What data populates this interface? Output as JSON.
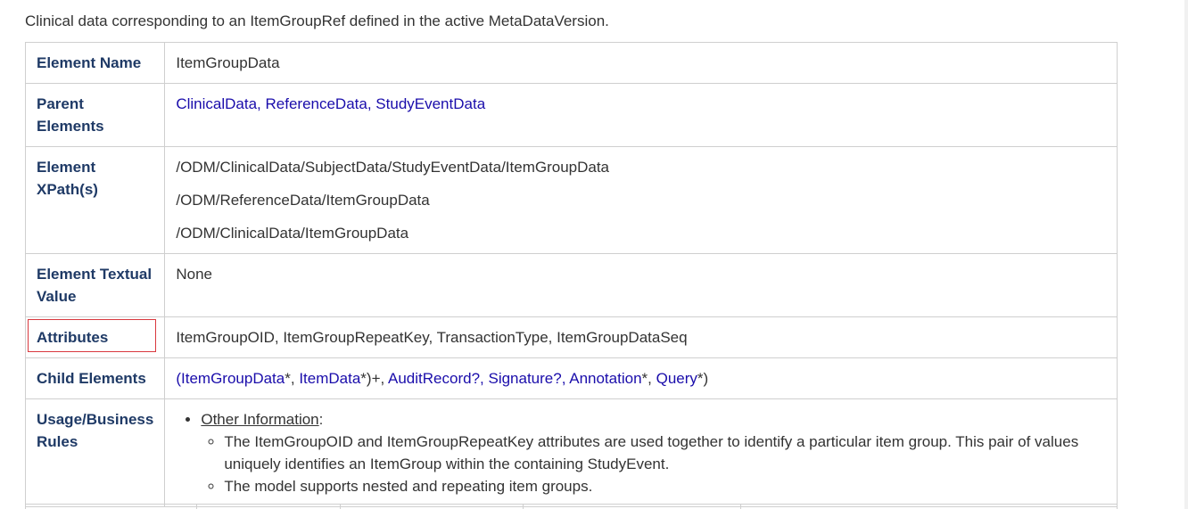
{
  "intro": "Clinical data corresponding to an ItemGroupRef defined in the active MetaDataVersion.",
  "rows": {
    "element_name": {
      "label": "Element Name",
      "value": "ItemGroupData"
    },
    "parent_elements": {
      "label": "Parent Elements",
      "links": [
        "ClinicalData",
        "ReferenceData",
        "StudyEventData"
      ],
      "separator": ", "
    },
    "xpaths": {
      "label": "Element XPath(s)",
      "values": [
        "/ODM/ClinicalData/SubjectData/StudyEventData/ItemGroupData",
        "/ODM/ReferenceData/ItemGroupData",
        "/ODM/ClinicalData/ItemGroupData"
      ]
    },
    "textual_value": {
      "label": "Element Textual Value",
      "value": "None"
    },
    "attributes": {
      "label": "Attributes",
      "value": "ItemGroupOID, ItemGroupRepeatKey, TransactionType, ItemGroupDataSeq"
    },
    "child_elements": {
      "label": "Child Elements",
      "open": "(",
      "link1": "ItemGroupData",
      "sym1": "*, ",
      "link2": "ItemData",
      "sym2": "*)+, ",
      "link3": "AuditRecord",
      "sym3": "?, ",
      "link4": "Signature",
      "sym4": "?, ",
      "link5": "Annotation",
      "sym5": "*, ",
      "link6": "Query",
      "sym6": "*)"
    },
    "usage": {
      "label": "Usage/Business Rules",
      "item_title": "Other Information",
      "item_colon": ":",
      "sub_items": [
        "The ItemGroupOID and ItemGroupRepeatKey attributes are used together to identify a particular item group. This pair of values uniquely identifies an ItemGroup within the containing StudyEvent.",
        "The model supports nested and repeating item groups."
      ]
    }
  },
  "colors": {
    "header_text": "#1f3a66",
    "link": "#1a0dab",
    "border": "#cfcfcf",
    "highlight": "#d9383e"
  }
}
